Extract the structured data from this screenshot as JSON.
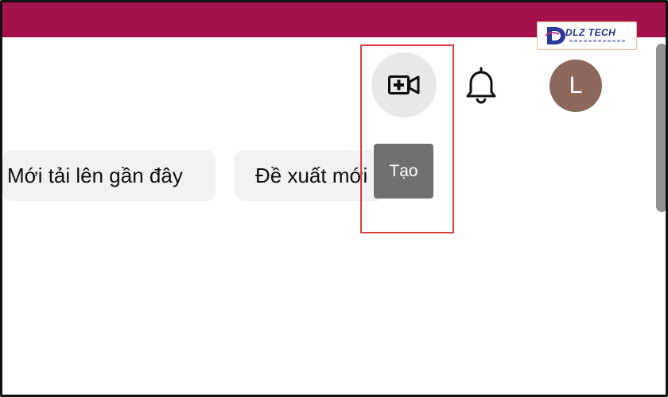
{
  "logo": {
    "text": "DLZ TECH"
  },
  "header": {
    "create_icon": "video-plus-icon",
    "notifications_icon": "bell-icon",
    "avatar_initial": "L"
  },
  "chips": [
    {
      "label": "Mới tải lên gần đây"
    },
    {
      "label": "Đề xuất mới"
    }
  ],
  "tooltip": {
    "text": "Tạo"
  },
  "colors": {
    "top_bar": "#a3124c",
    "avatar": "#8d675c",
    "tooltip": "#707070",
    "highlight": "#d9403a"
  }
}
